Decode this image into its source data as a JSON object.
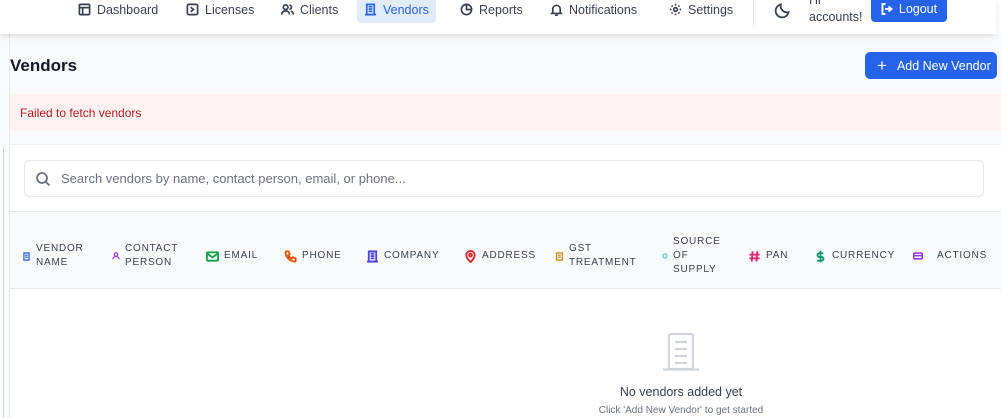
{
  "nav": {
    "items": [
      {
        "label": "Dashboard",
        "icon": "dashboard-icon"
      },
      {
        "label": "Licenses",
        "icon": "license-icon"
      },
      {
        "label": "Clients",
        "icon": "users-icon"
      },
      {
        "label": "Vendors",
        "icon": "building-icon",
        "active": true
      },
      {
        "label": "Reports",
        "icon": "pie-chart-icon"
      },
      {
        "label": "Notifications",
        "icon": "bell-icon"
      },
      {
        "label": "Settings",
        "icon": "gear-icon"
      }
    ],
    "greeting": "Hi accounts!",
    "logout_label": "Logout"
  },
  "page": {
    "title": "Vendors",
    "add_button": "Add New Vendor",
    "error": "Failed to fetch vendors"
  },
  "search": {
    "placeholder": "Search vendors by name, contact person, email, or phone..."
  },
  "table": {
    "columns": [
      {
        "label": "Vendor Name",
        "icon": "building-icon",
        "color": "#2563eb"
      },
      {
        "label": "Contact Person",
        "icon": "user-icon",
        "color": "#9333ea"
      },
      {
        "label": "Email",
        "icon": "mail-icon",
        "color": "#16a34a"
      },
      {
        "label": "Phone",
        "icon": "phone-icon",
        "color": "#ea580c"
      },
      {
        "label": "Company",
        "icon": "building-icon",
        "color": "#4f46e5"
      },
      {
        "label": "Address",
        "icon": "map-pin-icon",
        "color": "#dc2626"
      },
      {
        "label": "GST Treatment",
        "icon": "receipt-icon",
        "color": "#ca8a04"
      },
      {
        "label": "Source of Supply",
        "icon": "dot-icon",
        "color": "#14b8a6"
      },
      {
        "label": "PAN",
        "icon": "hash-icon",
        "color": "#db2777"
      },
      {
        "label": "Currency",
        "icon": "dollar-icon",
        "color": "#059669"
      },
      {
        "label": "Actions",
        "icon": "card-icon",
        "color": "#9333ea"
      }
    ],
    "empty_title": "No vendors added yet",
    "empty_subtitle": "Click 'Add New Vendor' to get started"
  },
  "colors": {
    "accent": "#2563eb",
    "error_bg": "#fdf1f1",
    "error_text": "#b91c1c"
  }
}
